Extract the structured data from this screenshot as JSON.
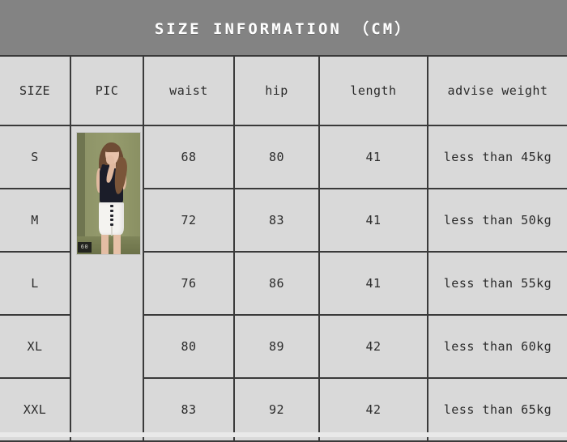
{
  "title": "SIZE INFORMATION （CM）",
  "colors": {
    "title_bar": "#838383",
    "title_text": "#ffffff",
    "cell_bg": "#d9d9d9",
    "border": "#3a3a3a",
    "text": "#2b2b2b",
    "photo_background": "#8d9366"
  },
  "table": {
    "headers": {
      "size": "SIZE",
      "pic": "PIC",
      "waist": "waist",
      "hip": "hip",
      "length": "length",
      "weight": "advise weight"
    },
    "rows": [
      {
        "size": "S",
        "waist": "68",
        "hip": "80",
        "length": "41",
        "weight": "less than 45kg"
      },
      {
        "size": "M",
        "waist": "72",
        "hip": "83",
        "length": "41",
        "weight": "less than 50kg"
      },
      {
        "size": "L",
        "waist": "76",
        "hip": "86",
        "length": "41",
        "weight": "less than 55kg"
      },
      {
        "size": "XL",
        "waist": "80",
        "hip": "89",
        "length": "42",
        "weight": "less than 60kg"
      },
      {
        "size": "XXL",
        "waist": "83",
        "hip": "92",
        "length": "42",
        "weight": "less than 65kg"
      }
    ]
  },
  "photo": {
    "watermark": "60"
  }
}
